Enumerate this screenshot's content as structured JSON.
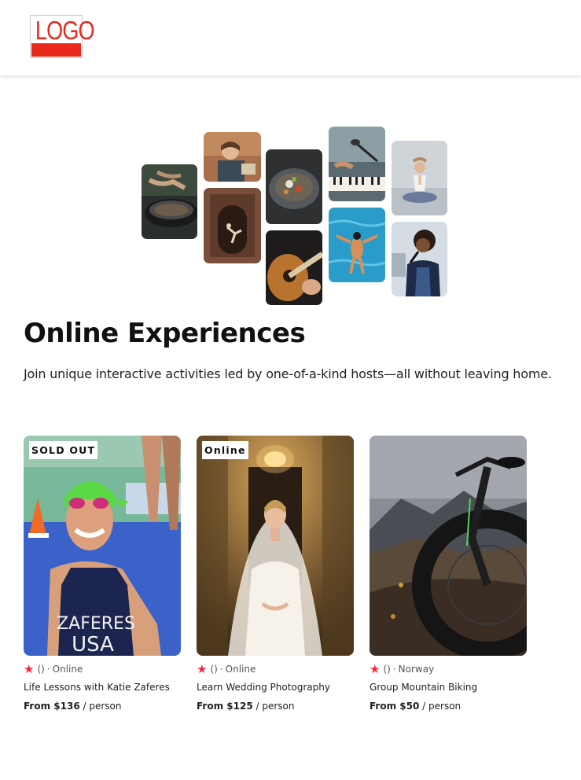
{
  "header": {
    "logo_text": "LOGO"
  },
  "hero": {
    "title": "Online Experiences",
    "subtitle": "Join unique interactive activities led by one-of-a-kind hosts—all without leaving home."
  },
  "collage": {
    "tiles": [
      {
        "subject": "cooking-pot-photo"
      },
      {
        "subject": "host-woman-photo"
      },
      {
        "subject": "dancer-doorway-photo"
      },
      {
        "subject": "food-bowl-photo"
      },
      {
        "subject": "guitar-photo"
      },
      {
        "subject": "piano-microphone-photo"
      },
      {
        "subject": "swimmer-photo"
      },
      {
        "subject": "yoga-photo"
      },
      {
        "subject": "singer-photo"
      }
    ]
  },
  "cards": [
    {
      "badge": "SOLD OUT",
      "rating": "()",
      "separator": "·",
      "location": "Online",
      "title": "Life Lessons with Katie Zaferes",
      "price_label": "From $136",
      "price_unit": "/ person",
      "image_text_1": "ZAFERES",
      "image_text_2": "USA"
    },
    {
      "badge": "Online",
      "rating": "()",
      "separator": "·",
      "location": "Online",
      "title": "Learn Wedding Photography",
      "price_label": "From $125",
      "price_unit": "/ person"
    },
    {
      "rating": "()",
      "separator": "·",
      "location": "Norway",
      "title": "Group Mountain Biking",
      "price_label": "From $50",
      "price_unit": "/ person"
    }
  ],
  "colors": {
    "accent_star": "#f0263e",
    "logo_red": "#e8291c"
  }
}
